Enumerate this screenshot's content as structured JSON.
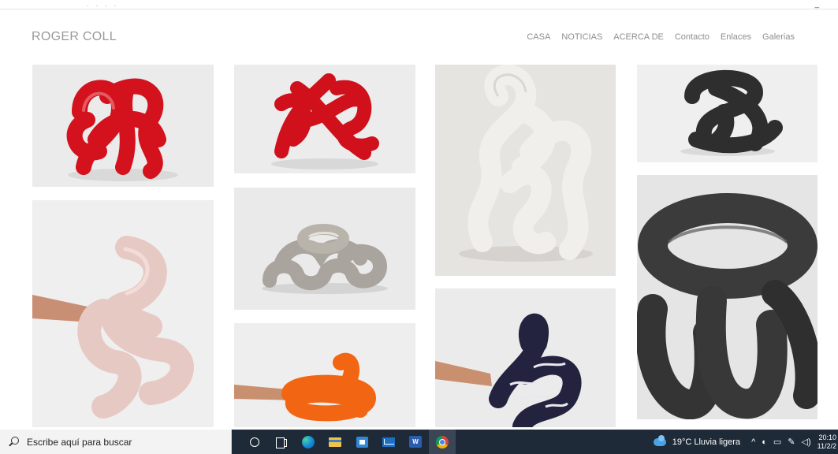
{
  "site": {
    "title": "ROGER COLL",
    "nav": [
      "CASA",
      "NOTICIAS",
      "ACERCA DE",
      "Contacto",
      "Enlaces",
      "Galerias"
    ]
  },
  "gallery": {
    "tiles": [
      {
        "id": "red-knot-1",
        "color": "#d3121d",
        "bg": "#ebebeb"
      },
      {
        "id": "red-knot-2",
        "color": "#d0101b",
        "bg": "#ececec"
      },
      {
        "id": "white-loops",
        "color": "#f1efeb",
        "bg": "#e6e4e1"
      },
      {
        "id": "black-knot-small",
        "color": "#2e2e2e",
        "bg": "#efefef"
      },
      {
        "id": "pink-wave",
        "color": "#e7c9c3",
        "bg": "#efefef"
      },
      {
        "id": "silver-links",
        "color": "#a9a49d",
        "bg": "#eaeaea"
      },
      {
        "id": "dark-rings",
        "color": "#3b3b3b",
        "bg": "#e5e5e5"
      },
      {
        "id": "orange-coil",
        "color": "#f26513",
        "bg": "#eeeeee"
      },
      {
        "id": "navy-stripes",
        "color": "#24233f",
        "bg": "#ebebeb"
      }
    ]
  },
  "taskbar": {
    "search_placeholder": "Escribe aquí para buscar",
    "word_label": "W",
    "weather": "19°C  Lluvia ligera",
    "tray_chevron": "^",
    "time": "20:10",
    "date": "11/2/2"
  }
}
